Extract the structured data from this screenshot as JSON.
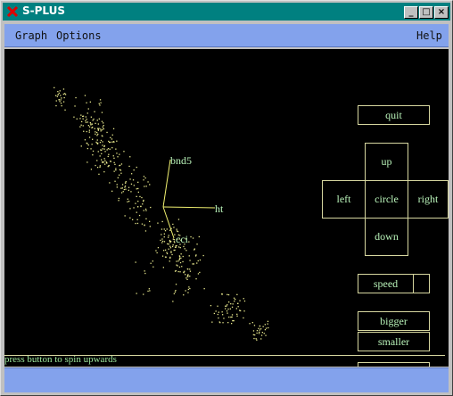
{
  "window": {
    "title": "S-PLUS",
    "accent": "#008080"
  },
  "titlebar_buttons": {
    "minimize": "_",
    "maximize": "□",
    "close": "×"
  },
  "menu": {
    "graph": "Graph",
    "options": "Options",
    "help": "Help"
  },
  "axes": {
    "a": "bnd5",
    "b": "ht",
    "c": "cci"
  },
  "controls": {
    "quit": "quit",
    "up": "up",
    "left": "left",
    "circle": "circle",
    "right": "right",
    "down": "down",
    "speed": "speed",
    "bigger": "bigger",
    "smaller": "smaller"
  },
  "status_text": "press button to spin upwards",
  "colors": {
    "points": "#e6e68c",
    "axes": "#f0f070",
    "text": "#b9f3b9",
    "menu_bg": "#83a2ec"
  }
}
